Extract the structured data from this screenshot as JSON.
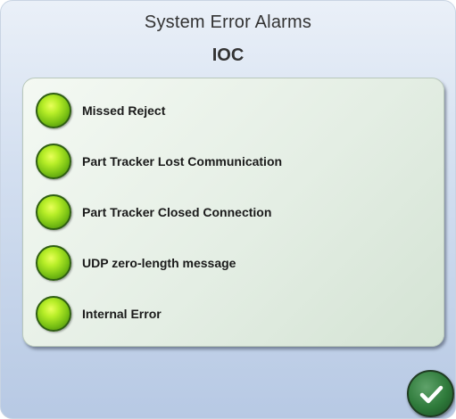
{
  "dialog": {
    "title": "System Error Alarms",
    "subtitle": "IOC"
  },
  "alarms": [
    {
      "label": "Missed Reject",
      "status": "ok",
      "color": "#8ed11c"
    },
    {
      "label": "Part Tracker Lost Communication",
      "status": "ok",
      "color": "#8ed11c"
    },
    {
      "label": "Part Tracker Closed Connection",
      "status": "ok",
      "color": "#8ed11c"
    },
    {
      "label": "UDP zero-length message",
      "status": "ok",
      "color": "#8ed11c"
    },
    {
      "label": "Internal Error",
      "status": "ok",
      "color": "#8ed11c"
    }
  ],
  "confirm_button": {
    "icon": "checkmark-icon",
    "color": "#2e7a3a"
  }
}
